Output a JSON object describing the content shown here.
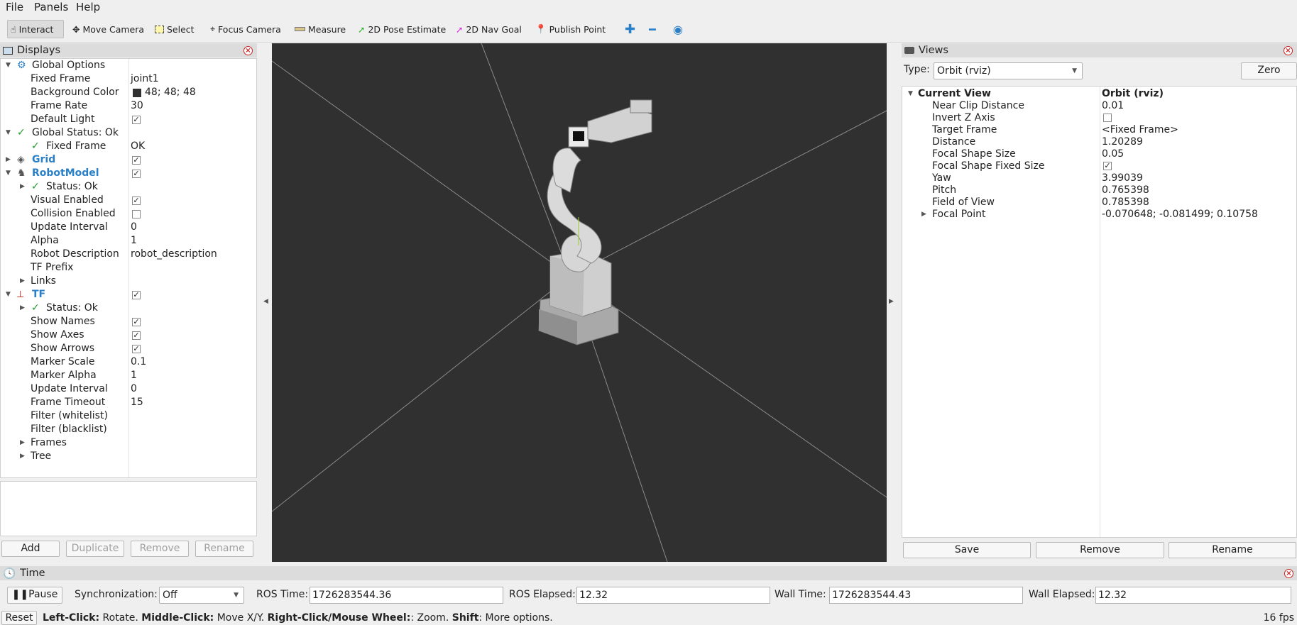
{
  "menu": {
    "file": "File",
    "panels": "Panels",
    "help": "Help"
  },
  "toolbar": {
    "interact": "Interact",
    "move_camera": "Move Camera",
    "select": "Select",
    "focus_camera": "Focus Camera",
    "measure": "Measure",
    "pose_estimate": "2D Pose Estimate",
    "nav_goal": "2D Nav Goal",
    "publish_point": "Publish Point"
  },
  "displays": {
    "title": "Displays",
    "rows": [
      {
        "label": "Global Options",
        "value": ""
      },
      {
        "label": "Fixed Frame",
        "value": "joint1"
      },
      {
        "label": "Background Color",
        "value": "48; 48; 48"
      },
      {
        "label": "Frame Rate",
        "value": "30"
      },
      {
        "label": "Default Light",
        "value": ""
      },
      {
        "label": "Global Status: Ok",
        "value": ""
      },
      {
        "label": "Fixed Frame",
        "value": "OK"
      },
      {
        "label": "Grid",
        "value": ""
      },
      {
        "label": "RobotModel",
        "value": ""
      },
      {
        "label": "Status: Ok",
        "value": ""
      },
      {
        "label": "Visual Enabled",
        "value": ""
      },
      {
        "label": "Collision Enabled",
        "value": ""
      },
      {
        "label": "Update Interval",
        "value": "0"
      },
      {
        "label": "Alpha",
        "value": "1"
      },
      {
        "label": "Robot Description",
        "value": "robot_description"
      },
      {
        "label": "TF Prefix",
        "value": ""
      },
      {
        "label": "Links",
        "value": ""
      },
      {
        "label": "TF",
        "value": ""
      },
      {
        "label": "Status: Ok",
        "value": ""
      },
      {
        "label": "Show Names",
        "value": ""
      },
      {
        "label": "Show Axes",
        "value": ""
      },
      {
        "label": "Show Arrows",
        "value": ""
      },
      {
        "label": "Marker Scale",
        "value": "0.1"
      },
      {
        "label": "Marker Alpha",
        "value": "1"
      },
      {
        "label": "Update Interval",
        "value": "0"
      },
      {
        "label": "Frame Timeout",
        "value": "15"
      },
      {
        "label": "Filter (whitelist)",
        "value": ""
      },
      {
        "label": "Filter (blacklist)",
        "value": ""
      },
      {
        "label": "Frames",
        "value": ""
      },
      {
        "label": "Tree",
        "value": ""
      }
    ],
    "buttons": {
      "add": "Add",
      "duplicate": "Duplicate",
      "remove": "Remove",
      "rename": "Rename"
    },
    "background_color_swatch": "#303030"
  },
  "views": {
    "title": "Views",
    "type_label": "Type:",
    "type_value": "Orbit (rviz)",
    "zero": "Zero",
    "current_view": {
      "label": "Current View",
      "value": "Orbit (rviz)"
    },
    "rows": [
      {
        "label": "Near Clip Distance",
        "value": "0.01"
      },
      {
        "label": "Invert Z Axis",
        "value": ""
      },
      {
        "label": "Target Frame",
        "value": "<Fixed Frame>"
      },
      {
        "label": "Distance",
        "value": "1.20289"
      },
      {
        "label": "Focal Shape Size",
        "value": "0.05"
      },
      {
        "label": "Focal Shape Fixed Size",
        "value": ""
      },
      {
        "label": "Yaw",
        "value": "3.99039"
      },
      {
        "label": "Pitch",
        "value": "0.765398"
      },
      {
        "label": "Field of View",
        "value": "0.785398"
      },
      {
        "label": "Focal Point",
        "value": "-0.070648; -0.081499; 0.10758"
      }
    ],
    "buttons": {
      "save": "Save",
      "remove": "Remove",
      "rename": "Rename"
    }
  },
  "time": {
    "title": "Time",
    "pause": "Pause",
    "sync_label": "Synchronization:",
    "sync_value": "Off",
    "ros_time_label": "ROS Time:",
    "ros_time": "1726283544.36",
    "ros_elapsed_label": "ROS Elapsed:",
    "ros_elapsed": "12.32",
    "wall_time_label": "Wall Time:",
    "wall_time": "1726283544.43",
    "wall_elapsed_label": "Wall Elapsed:",
    "wall_elapsed": "12.32"
  },
  "status": {
    "reset": "Reset",
    "left_click": "Left-Click:",
    "left_desc": " Rotate. ",
    "middle_click": "Middle-Click:",
    "middle_desc": " Move X/Y. ",
    "right_click": "Right-Click/Mouse Wheel:",
    "right_desc": ": Zoom. ",
    "shift": "Shift",
    "shift_desc": ": More options.",
    "fps": "16 fps"
  },
  "colors": {
    "viewport_bg": "#303030",
    "status_ok": "#1f9b2d",
    "display_name": "#2a7fc9"
  }
}
